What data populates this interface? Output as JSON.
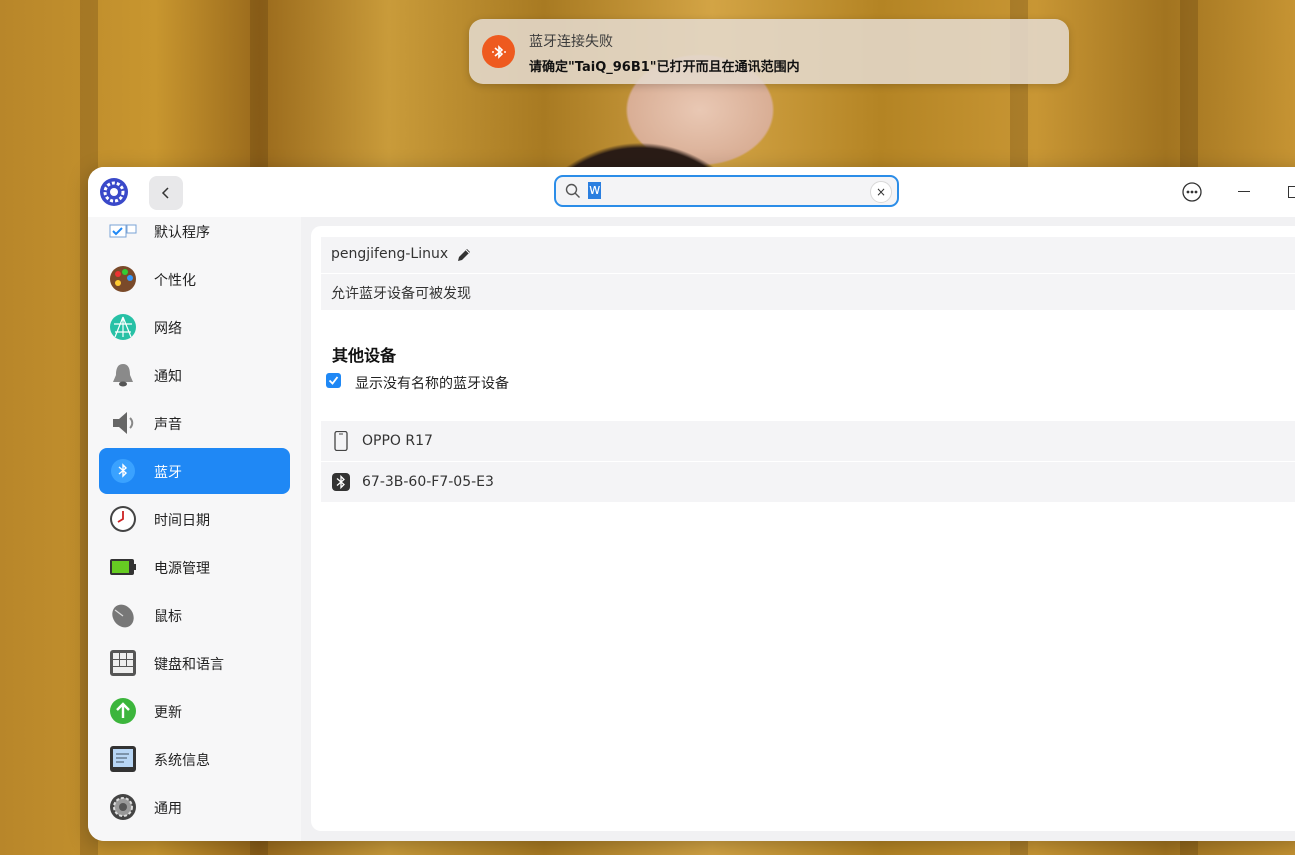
{
  "notification": {
    "title": "蓝牙连接失败",
    "body": "请确定\"TaiQ_96B1\"已打开而且在通讯范围内",
    "icon": "bluetooth-error-icon",
    "accent": "#ee5a1f"
  },
  "titlebar": {
    "search_value": "w",
    "clear_label": "×"
  },
  "sidebar": {
    "items": [
      {
        "label": "默认程序",
        "icon": "default-apps-icon"
      },
      {
        "label": "个性化",
        "icon": "palette-icon"
      },
      {
        "label": "网络",
        "icon": "network-icon"
      },
      {
        "label": "通知",
        "icon": "bell-icon"
      },
      {
        "label": "声音",
        "icon": "speaker-icon"
      },
      {
        "label": "蓝牙",
        "icon": "bluetooth-icon"
      },
      {
        "label": "时间日期",
        "icon": "clock-icon"
      },
      {
        "label": "电源管理",
        "icon": "battery-icon"
      },
      {
        "label": "鼠标",
        "icon": "mouse-icon"
      },
      {
        "label": "键盘和语言",
        "icon": "keyboard-icon"
      },
      {
        "label": "更新",
        "icon": "update-icon"
      },
      {
        "label": "系统信息",
        "icon": "system-info-icon"
      },
      {
        "label": "通用",
        "icon": "general-icon"
      }
    ],
    "active_color": "#1f88f5"
  },
  "bluetooth": {
    "device_name": "pengjifeng-Linux",
    "discoverable_label": "允许蓝牙设备可被发现",
    "other_devices_title": "其他设备",
    "show_unnamed_label": "显示没有名称的蓝牙设备",
    "show_unnamed_checked": true,
    "devices": [
      {
        "name": "OPPO R17",
        "icon": "phone-icon"
      },
      {
        "name": "67-3B-60-F7-05-E3",
        "icon": "bluetooth-icon"
      }
    ]
  }
}
